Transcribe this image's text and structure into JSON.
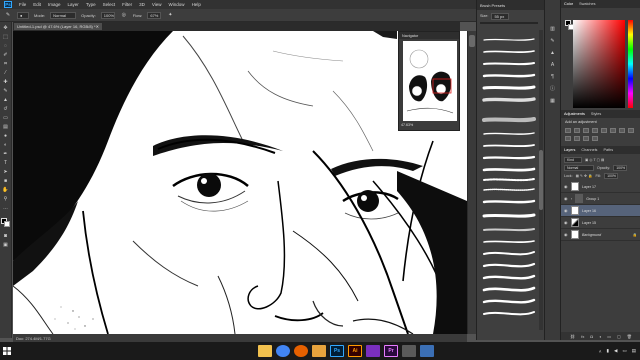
{
  "app": {
    "logo": "Ps"
  },
  "menu": [
    "File",
    "Edit",
    "Image",
    "Layer",
    "Type",
    "Select",
    "Filter",
    "3D",
    "View",
    "Window",
    "Help"
  ],
  "options": {
    "mode_label": "Mode:",
    "mode": "Normal",
    "opacity_label": "Opacity:",
    "opacity": "100%",
    "flow_label": "Flow:",
    "flow": "67%",
    "workspace": "Essentials"
  },
  "document": {
    "tab_title": "Untitled-1.psd @ 47.6% (Layer 16, RGB/8) *",
    "status": "Doc: 274.4M/1.77G"
  },
  "navigator": {
    "title": "Navigator",
    "zoom": "47.63%"
  },
  "brush_panel": {
    "title": "Brush Presets",
    "size_label": "Size:",
    "size": "55 px"
  },
  "color_panel": {
    "tabs": [
      "Color",
      "Swatches"
    ]
  },
  "adjustments": {
    "tabs": [
      "Adjustments",
      "Styles"
    ],
    "title": "Add an adjustment"
  },
  "layers": {
    "tabs": [
      "Layers",
      "Channels",
      "Paths"
    ],
    "kind": "Kind",
    "blend": "Normal",
    "opacity_label": "Opacity:",
    "opacity": "100%",
    "lock_label": "Lock:",
    "fill_label": "Fill:",
    "fill": "100%",
    "items": [
      {
        "name": "Layer 17",
        "selected": false,
        "folder": false
      },
      {
        "name": "Group 1",
        "selected": false,
        "folder": true
      },
      {
        "name": "Layer 16",
        "selected": true,
        "folder": false
      },
      {
        "name": "Layer 15",
        "selected": false,
        "folder": false
      },
      {
        "name": "Background",
        "selected": false,
        "folder": false
      }
    ]
  },
  "taskbar": {
    "apps": [
      {
        "icon": "file-explorer-icon",
        "color": "#f2c14e",
        "glyph": ""
      },
      {
        "icon": "chrome-icon",
        "color": "#4285f4",
        "glyph": ""
      },
      {
        "icon": "firefox-icon",
        "color": "#e66000",
        "glyph": ""
      },
      {
        "icon": "folder-icon",
        "color": "#e8a33d",
        "glyph": ""
      },
      {
        "icon": "photoshop-icon",
        "color": "#001e36",
        "glyph": "Ps"
      },
      {
        "icon": "illustrator-icon",
        "color": "#330000",
        "glyph": "Ai"
      },
      {
        "icon": "media-icon",
        "color": "#7a2fbf",
        "glyph": ""
      },
      {
        "icon": "premiere-icon",
        "color": "#2a0a3d",
        "glyph": "Pr"
      },
      {
        "icon": "app-icon",
        "color": "#5a5a5a",
        "glyph": ""
      },
      {
        "icon": "app2-icon",
        "color": "#3b6fb5",
        "glyph": ""
      }
    ]
  },
  "colors": {
    "accent": "#56637a"
  }
}
